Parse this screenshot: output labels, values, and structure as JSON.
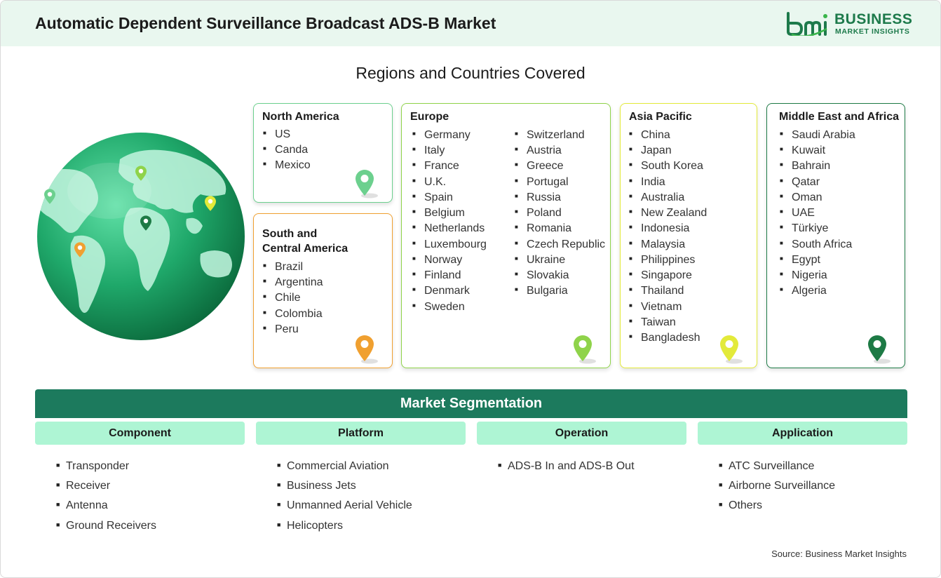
{
  "header": {
    "title": "Automatic Dependent Surveillance Broadcast ADS-B Market",
    "logo_word1": "BUSINESS",
    "logo_word2": "MARKET INSIGHTS"
  },
  "regions_title": "Regions and Countries Covered",
  "regions": {
    "north_america": {
      "title": "North America",
      "items": [
        "US",
        "Canda",
        "Mexico"
      ],
      "color": "#6cd08e"
    },
    "south_central_america": {
      "title_line1": "South and",
      "title_line2": "Central America",
      "items": [
        "Brazil",
        "Argentina",
        "Chile",
        "Colombia",
        "Peru"
      ],
      "color": "#f0a030"
    },
    "europe": {
      "title": "Europe",
      "col1": [
        "Germany",
        "Italy",
        "France",
        "U.K.",
        "Spain",
        "Belgium",
        "Netherlands",
        "Luxembourg",
        "Norway",
        "Finland",
        "Denmark",
        "Sweden"
      ],
      "col2": [
        "Switzerland",
        "Austria",
        "Greece",
        "Portugal",
        "Russia",
        "Poland",
        "Romania",
        "Czech Republic",
        "Ukraine",
        "Slovakia",
        "Bulgaria"
      ],
      "color": "#8fd34a"
    },
    "asia_pacific": {
      "title": "Asia Pacific",
      "items": [
        "China",
        "Japan",
        "South Korea",
        "India",
        "Australia",
        "New Zealand",
        "Indonesia",
        "Malaysia",
        "Philippines",
        "Singapore",
        "Thailand",
        "Vietnam",
        "Taiwan",
        "Bangladesh"
      ],
      "color": "#e3ea3a"
    },
    "middle_east_africa": {
      "title": "Middle East and Africa",
      "items": [
        "Saudi Arabia",
        "Kuwait",
        "Bahrain",
        "Qatar",
        "Oman",
        "UAE",
        "Türkiye",
        "South Africa",
        "Egypt",
        "Nigeria",
        "Algeria"
      ],
      "color": "#1d7a45"
    }
  },
  "segmentation": {
    "title": "Market Segmentation",
    "columns": [
      {
        "header": "Component",
        "items": [
          "Transponder",
          "Receiver",
          "Antenna",
          "Ground Receivers"
        ]
      },
      {
        "header": "Platform",
        "items": [
          "Commercial Aviation",
          "Business Jets",
          "Unmanned Aerial Vehicle",
          "Helicopters"
        ]
      },
      {
        "header": "Operation",
        "items": [
          "ADS-B In and ADS-B Out"
        ]
      },
      {
        "header": "Application",
        "items": [
          "ATC Surveillance",
          "Airborne Surveillance",
          "Others"
        ]
      }
    ]
  },
  "source": "Source: Business Market Insights",
  "icons": [
    "globe-icon",
    "location-pin-icon",
    "bmi-logo-icon"
  ]
}
